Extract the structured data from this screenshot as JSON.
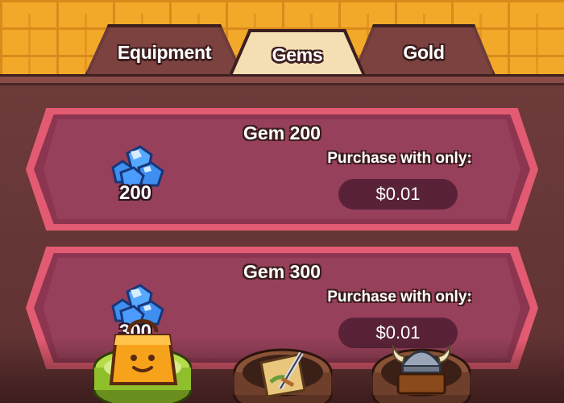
{
  "tabs": [
    {
      "label": "Equipment",
      "active": false
    },
    {
      "label": "Gems",
      "active": true
    },
    {
      "label": "Gold",
      "active": false
    }
  ],
  "offers": [
    {
      "title": "Gem 200",
      "amount": "200",
      "purchase_label": "Purchase with only:",
      "price": "$0.01"
    },
    {
      "title": "Gem 300",
      "amount": "300",
      "purchase_label": "Purchase with only:",
      "price": "$0.01"
    }
  ],
  "bottom_nav": [
    {
      "icon": "shopping-bag-icon",
      "active": true
    },
    {
      "icon": "map-sword-icon",
      "active": false
    },
    {
      "icon": "viking-helmet-chest-icon",
      "active": false
    }
  ],
  "colors": {
    "wall": "#f2a92a",
    "card_border": "#e35b72",
    "card_fill": "#8c3551",
    "price_pill": "#5a2238",
    "active_tab": "#f4deb3",
    "gem_blue": "#3f8ff0"
  }
}
